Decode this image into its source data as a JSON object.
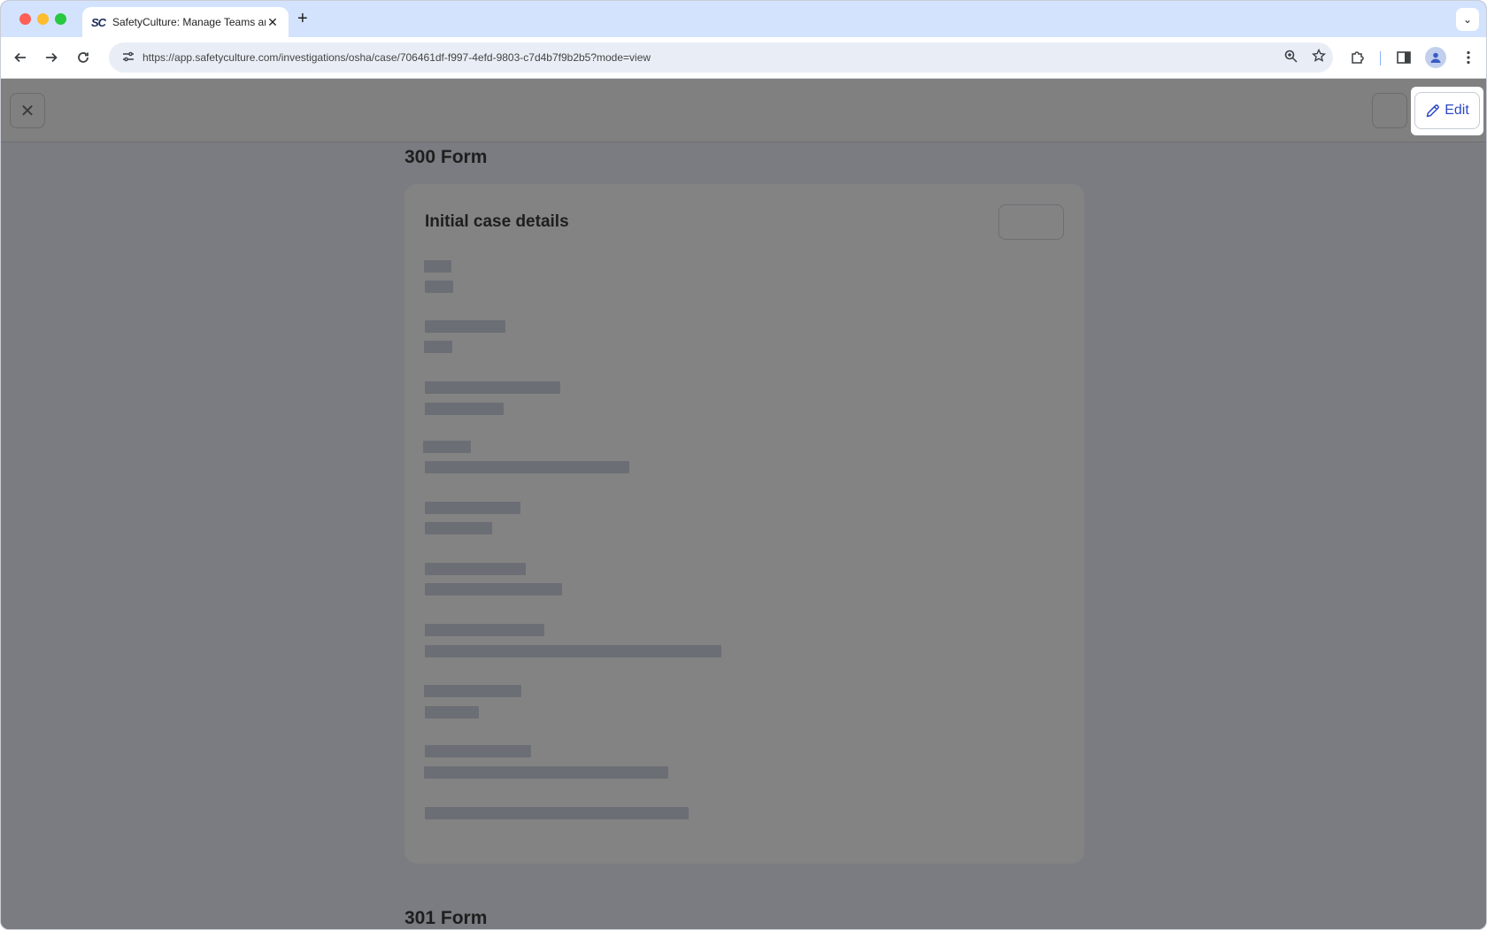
{
  "browser": {
    "tab_favicon": "SC",
    "tab_title": "SafetyCulture: Manage Teams and...",
    "tab_close": "✕",
    "new_tab": "+",
    "tab_menu": "⌄",
    "url": "https://app.safetyculture.com/investigations/osha/case/706461df-f997-4efd-9803-c7d4b7f9b2b5?mode=view"
  },
  "header": {
    "close_icon": "✕",
    "edit_label": "Edit"
  },
  "sections": {
    "form300_title": "300 Form",
    "card_title": "Initial case details",
    "form301_title": "301 Form"
  },
  "colors": {
    "accent": "#2d48c7",
    "overlay": "#7b7c82",
    "skeleton": "#6c6e75"
  }
}
